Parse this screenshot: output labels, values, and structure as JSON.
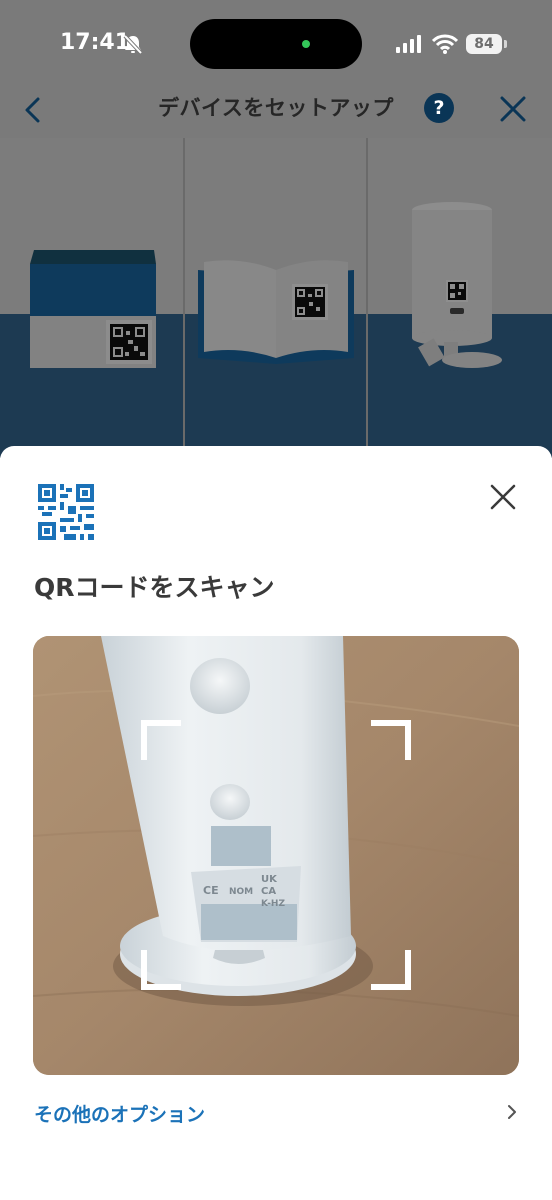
{
  "status_bar": {
    "time": "17:41",
    "battery": "84",
    "icons": [
      "bell-slash-icon",
      "signal-icon",
      "wifi-icon",
      "battery-icon"
    ]
  },
  "nav": {
    "title": "デバイスをセットアップ",
    "help": "?",
    "icons": [
      "chevron-left-icon",
      "help-icon",
      "close-icon"
    ]
  },
  "sheet": {
    "title": "QRコードをスキャン",
    "options_link": "その他のオプション",
    "icons": [
      "qr-code-icon",
      "close-icon",
      "chevron-right-icon"
    ]
  },
  "colors": {
    "accent": "#1b72b8",
    "help_badge": "#0a3556",
    "dim_overlay": "#7a7a7a",
    "floor": "#1d3a52"
  }
}
